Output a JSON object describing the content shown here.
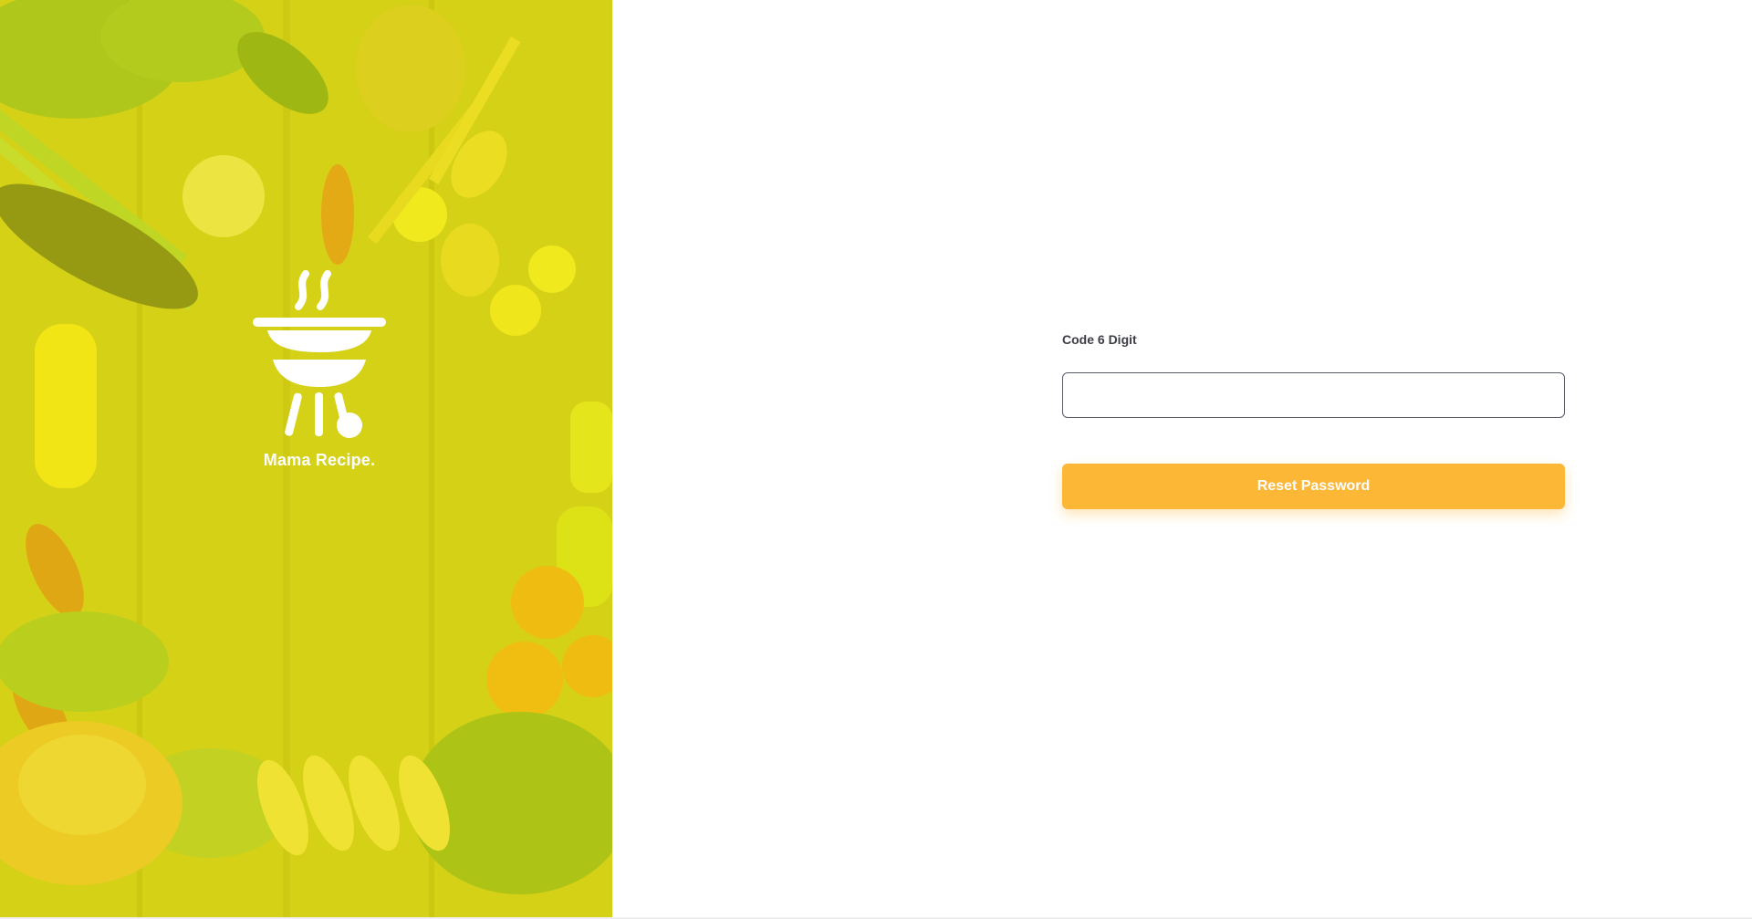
{
  "brand": {
    "name": "Mama Recipe."
  },
  "form": {
    "code_label": "Code 6 Digit",
    "code_value": "",
    "submit_label": "Reset Password"
  },
  "colors": {
    "accent": "#fdb737",
    "overlay": "#eee812",
    "label_text": "#3d3d46"
  },
  "icons": {
    "logo": "barbecue-grill-icon"
  }
}
